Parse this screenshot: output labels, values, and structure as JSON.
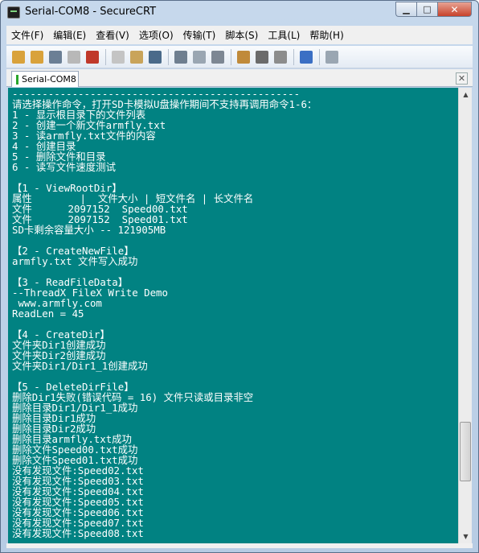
{
  "window": {
    "title": "Serial-COM8 - SecureCRT",
    "min_glyph": "▁",
    "max_glyph": "□",
    "close_glyph": "✕"
  },
  "menu": [
    {
      "label": "文件(F)"
    },
    {
      "label": "编辑(E)"
    },
    {
      "label": "查看(V)"
    },
    {
      "label": "选项(O)"
    },
    {
      "label": "传输(T)"
    },
    {
      "label": "脚本(S)"
    },
    {
      "label": "工具(L)"
    },
    {
      "label": "帮助(H)"
    }
  ],
  "toolbar": [
    {
      "icon": "connect-icon",
      "color": "#d9a23b"
    },
    {
      "icon": "quick-connect-icon",
      "color": "#d9a23b"
    },
    {
      "icon": "connect-in-tab-icon",
      "color": "#6b7f95"
    },
    {
      "icon": "reconnect-icon",
      "color": "#b8b8b8"
    },
    {
      "icon": "disconnect-icon",
      "color": "#c0392b"
    },
    {
      "sep": true
    },
    {
      "icon": "copy-icon",
      "color": "#c4c4c4"
    },
    {
      "icon": "paste-icon",
      "color": "#c9a45a"
    },
    {
      "icon": "find-icon",
      "color": "#4a6a8a"
    },
    {
      "sep": true
    },
    {
      "icon": "print-screen-icon",
      "color": "#6f7f90"
    },
    {
      "icon": "print-selection-icon",
      "color": "#9aa6b2"
    },
    {
      "icon": "print-icon",
      "color": "#7d8793"
    },
    {
      "sep": true
    },
    {
      "icon": "session-options-icon",
      "color": "#c08a3a"
    },
    {
      "icon": "global-options-icon",
      "color": "#6b6b6b"
    },
    {
      "icon": "keymap-icon",
      "color": "#8c8c8c"
    },
    {
      "sep": true
    },
    {
      "icon": "help-icon",
      "color": "#3b6fc4"
    },
    {
      "sep": true
    },
    {
      "icon": "tile-icon",
      "color": "#9aa6b2"
    }
  ],
  "tabs": [
    {
      "label": "Serial-COM8",
      "status_color": "#2aa52a"
    }
  ],
  "tab_close_glyph": "✕",
  "terminal": {
    "background": "#018282",
    "foreground": "#ffffff",
    "lines": [
      "------------------------------------------------",
      "请选择操作命令，打开SD卡模拟U盘操作期间不支持再调用命令1-6：",
      "1 - 显示根目录下的文件列表",
      "2 - 创建一个新文件armfly.txt",
      "3 - 读armfly.txt文件的内容",
      "4 - 创建目录",
      "5 - 删除文件和目录",
      "6 - 读写文件速度测试",
      "",
      "【1 - ViewRootDir】",
      "属性        |  文件大小 | 短文件名 | 长文件名",
      "文件      2097152  Speed00.txt",
      "文件      2097152  Speed01.txt",
      "SD卡剩余容量大小 -- 121905MB",
      "",
      "【2 - CreateNewFile】",
      "armfly.txt 文件写入成功",
      "",
      "【3 - ReadFileData】",
      "--ThreadX FileX Write Demo",
      " www.armfly.com",
      "ReadLen = 45",
      "",
      "【4 - CreateDir】",
      "文件夹Dir1创建成功",
      "文件夹Dir2创建成功",
      "文件夹Dir1/Dir1_1创建成功",
      "",
      "【5 - DeleteDirFile】",
      "删除Dir1失败(错误代码 = 16) 文件只读或目录非空",
      "删除目录Dir1/Dir1_1成功",
      "删除目录Dir1成功",
      "删除目录Dir2成功",
      "删除目录armfly.txt成功",
      "删除文件Speed00.txt成功",
      "删除文件Speed01.txt成功",
      "没有发现文件:Speed02.txt",
      "没有发现文件:Speed03.txt",
      "没有发现文件:Speed04.txt",
      "没有发现文件:Speed05.txt",
      "没有发现文件:Speed06.txt",
      "没有发现文件:Speed07.txt",
      "没有发现文件:Speed08.txt"
    ]
  },
  "scrollbar": {
    "up_glyph": "▲",
    "down_glyph": "▼",
    "position": 0.87,
    "visible_fraction": 0.14
  }
}
